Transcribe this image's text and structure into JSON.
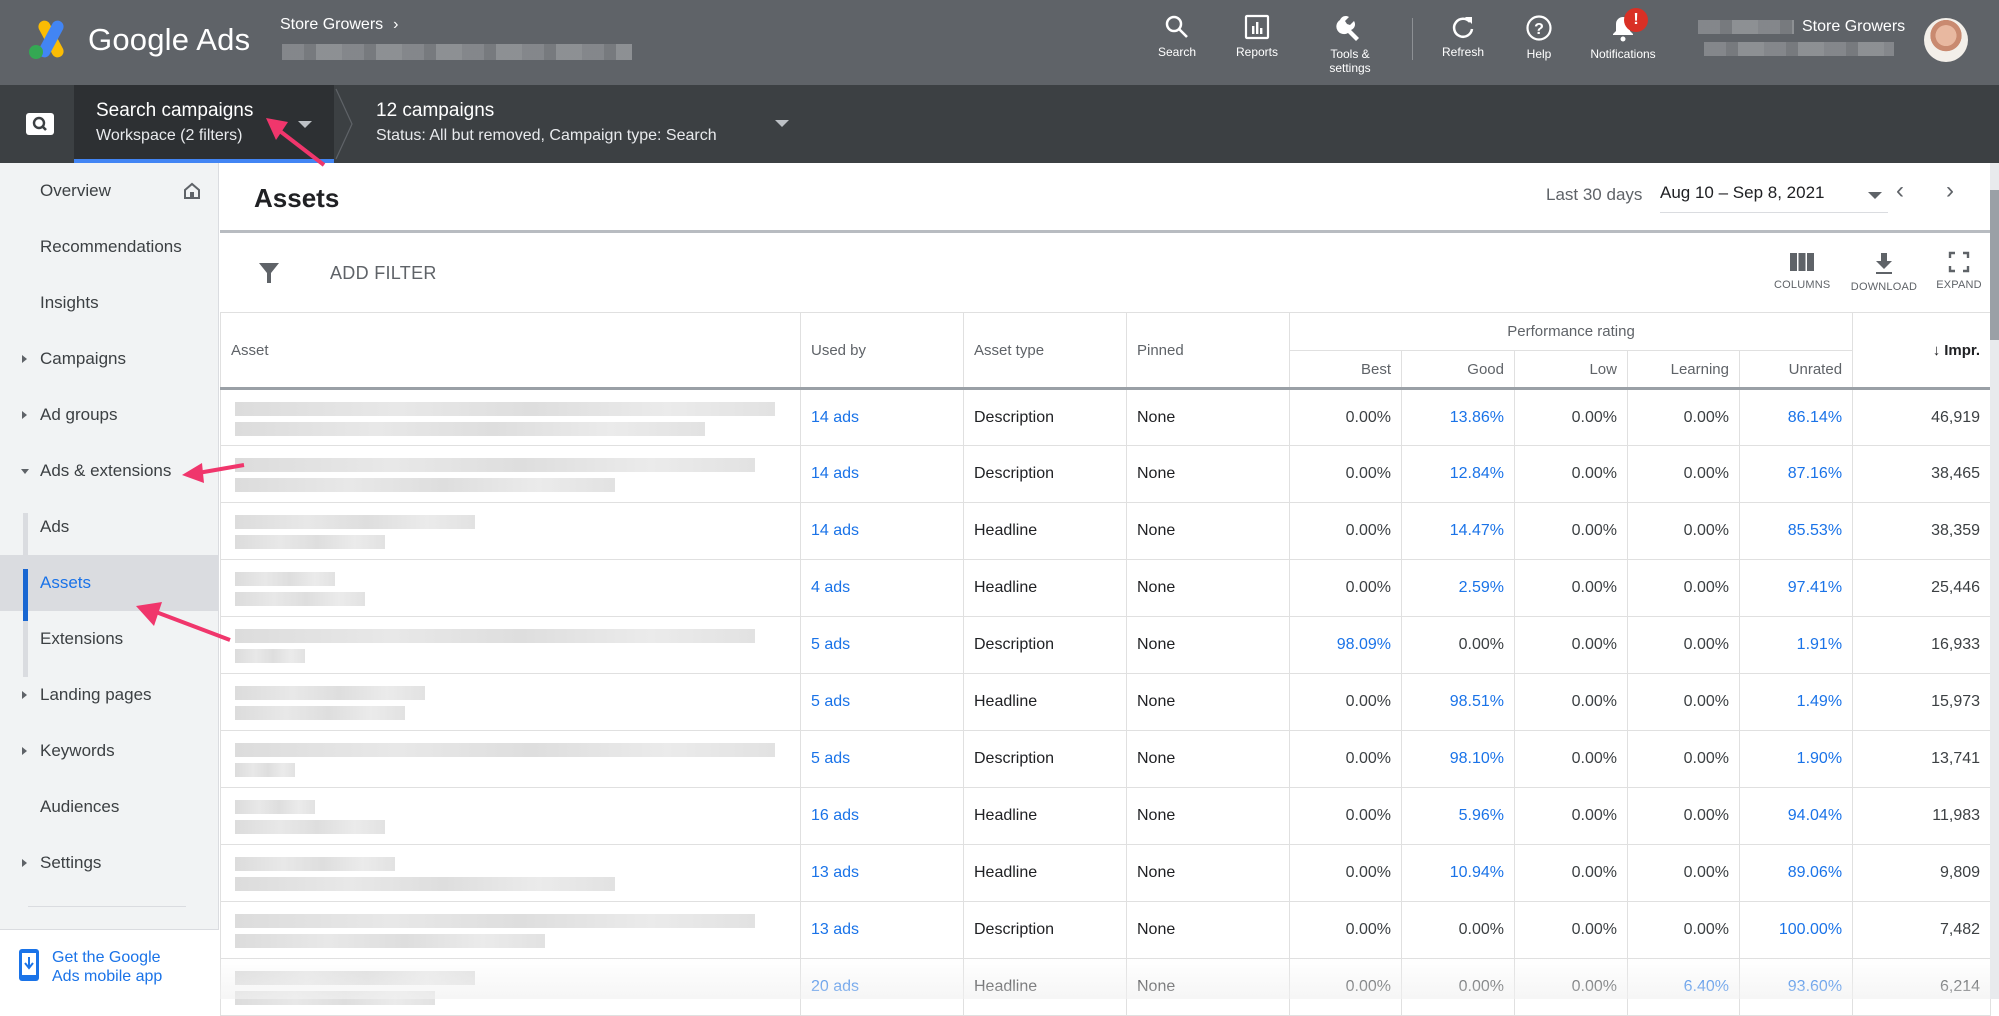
{
  "header": {
    "brand": "Google Ads",
    "account_name": "Store Growers",
    "tools": [
      {
        "label": "Search",
        "icon": "search-icon"
      },
      {
        "label": "Reports",
        "icon": "reports-icon"
      },
      {
        "label": "Tools & settings",
        "icon": "wrench-icon"
      },
      {
        "label": "Refresh",
        "icon": "refresh-icon"
      },
      {
        "label": "Help",
        "icon": "help-icon"
      },
      {
        "label": "Notifications",
        "icon": "bell-icon"
      }
    ],
    "notification_badge": "!",
    "user_label": "Store Growers"
  },
  "subheader": {
    "workspace_title": "Search campaigns",
    "workspace_sub": "Workspace (2 filters)",
    "campaigns_title": "12 campaigns",
    "campaigns_sub": "Status: All but removed, Campaign type: Search"
  },
  "sidebar": {
    "items": [
      {
        "label": "Overview",
        "expandable": false
      },
      {
        "label": "Recommendations",
        "expandable": false
      },
      {
        "label": "Insights",
        "expandable": false
      },
      {
        "label": "Campaigns",
        "expandable": true
      },
      {
        "label": "Ad groups",
        "expandable": true
      },
      {
        "label": "Ads & extensions",
        "expandable": true,
        "expanded": true
      },
      {
        "label": "Ads",
        "sub": true
      },
      {
        "label": "Assets",
        "sub": true,
        "active": true
      },
      {
        "label": "Extensions",
        "sub": true
      },
      {
        "label": "Landing pages",
        "expandable": true
      },
      {
        "label": "Keywords",
        "expandable": true
      },
      {
        "label": "Audiences",
        "expandable": false
      },
      {
        "label": "Settings",
        "expandable": true
      }
    ],
    "mobile_promo": "Get the Google Ads mobile app",
    "mobile_promo_line1": "Get the Google",
    "mobile_promo_line2": "Ads mobile app"
  },
  "main": {
    "title": "Assets",
    "date_range_label": "Last 30 days",
    "date_range_value": "Aug 10 – Sep 8, 2021",
    "add_filter": "ADD FILTER",
    "toolbar": {
      "columns": "COLUMNS",
      "download": "DOWNLOAD",
      "expand": "EXPAND"
    },
    "table": {
      "group_header": "Performance rating",
      "columns": [
        "Asset",
        "Used by",
        "Asset type",
        "Pinned",
        "Best",
        "Good",
        "Low",
        "Learning",
        "Unrated",
        "Impr."
      ],
      "sort_indicator": "↓",
      "rows": [
        {
          "used_by": "14 ads",
          "type": "Description",
          "pinned": "None",
          "best": "0.00%",
          "good": "13.86%",
          "low": "0.00%",
          "learning": "0.00%",
          "unrated": "86.14%",
          "impr": "46,919"
        },
        {
          "used_by": "14 ads",
          "type": "Description",
          "pinned": "None",
          "best": "0.00%",
          "good": "12.84%",
          "low": "0.00%",
          "learning": "0.00%",
          "unrated": "87.16%",
          "impr": "38,465"
        },
        {
          "used_by": "14 ads",
          "type": "Headline",
          "pinned": "None",
          "best": "0.00%",
          "good": "14.47%",
          "low": "0.00%",
          "learning": "0.00%",
          "unrated": "85.53%",
          "impr": "38,359"
        },
        {
          "used_by": "4 ads",
          "type": "Headline",
          "pinned": "None",
          "best": "0.00%",
          "good": "2.59%",
          "low": "0.00%",
          "learning": "0.00%",
          "unrated": "97.41%",
          "impr": "25,446"
        },
        {
          "used_by": "5 ads",
          "type": "Description",
          "pinned": "None",
          "best": "98.09%",
          "good": "0.00%",
          "low": "0.00%",
          "learning": "0.00%",
          "unrated": "1.91%",
          "impr": "16,933"
        },
        {
          "used_by": "5 ads",
          "type": "Headline",
          "pinned": "None",
          "best": "0.00%",
          "good": "98.51%",
          "low": "0.00%",
          "learning": "0.00%",
          "unrated": "1.49%",
          "impr": "15,973"
        },
        {
          "used_by": "5 ads",
          "type": "Description",
          "pinned": "None",
          "best": "0.00%",
          "good": "98.10%",
          "low": "0.00%",
          "learning": "0.00%",
          "unrated": "1.90%",
          "impr": "13,741"
        },
        {
          "used_by": "16 ads",
          "type": "Headline",
          "pinned": "None",
          "best": "0.00%",
          "good": "5.96%",
          "low": "0.00%",
          "learning": "0.00%",
          "unrated": "94.04%",
          "impr": "11,983"
        },
        {
          "used_by": "13 ads",
          "type": "Headline",
          "pinned": "None",
          "best": "0.00%",
          "good": "10.94%",
          "low": "0.00%",
          "learning": "0.00%",
          "unrated": "89.06%",
          "impr": "9,809"
        },
        {
          "used_by": "13 ads",
          "type": "Description",
          "pinned": "None",
          "best": "0.00%",
          "good": "0.00%",
          "low": "0.00%",
          "learning": "0.00%",
          "unrated": "100.00%",
          "impr": "7,482"
        },
        {
          "used_by": "20 ads",
          "type": "Headline",
          "pinned": "None",
          "best": "0.00%",
          "good": "0.00%",
          "low": "0.00%",
          "learning": "6.40%",
          "unrated": "93.60%",
          "impr": "6,214"
        }
      ]
    }
  },
  "colors": {
    "topbar": "#5f6368",
    "subbar": "#3c4043",
    "accent": "#1a73e8",
    "annotation": "#f0366c",
    "badge": "#d93025"
  }
}
